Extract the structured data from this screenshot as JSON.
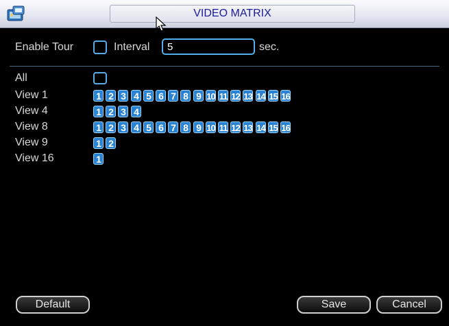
{
  "window": {
    "title": "VIDEO MATRIX"
  },
  "tour": {
    "enable_label": "Enable Tour",
    "enable_checked": false,
    "interval_label": "Interval",
    "interval_value": "5",
    "unit": "sec."
  },
  "views": {
    "all_label": "All",
    "all_checked": false,
    "rows": [
      {
        "label": "View 1",
        "numbers": [
          "1",
          "2",
          "3",
          "4",
          "5",
          "6",
          "7",
          "8",
          "9",
          "10",
          "11",
          "12",
          "13",
          "14",
          "15",
          "16"
        ]
      },
      {
        "label": "View 4",
        "numbers": [
          "1",
          "2",
          "3",
          "4"
        ]
      },
      {
        "label": "View 8",
        "numbers": [
          "1",
          "2",
          "3",
          "4",
          "5",
          "6",
          "7",
          "8",
          "9",
          "10",
          "11",
          "12",
          "13",
          "14",
          "15",
          "16"
        ]
      },
      {
        "label": "View 9",
        "numbers": [
          "1",
          "2"
        ]
      },
      {
        "label": "View 16",
        "numbers": [
          "1"
        ]
      }
    ]
  },
  "buttons": {
    "default_label": "Default",
    "save_label": "Save",
    "cancel_label": "Cancel"
  },
  "colors": {
    "background": "#000000",
    "accent_border": "#55aeea",
    "number_fill": "#2a83d2",
    "title_text": "#1a1a9a",
    "label_text": "#d8d8d8"
  },
  "icons": {
    "app": "app-icon",
    "cursor": "mouse-pointer-icon"
  }
}
